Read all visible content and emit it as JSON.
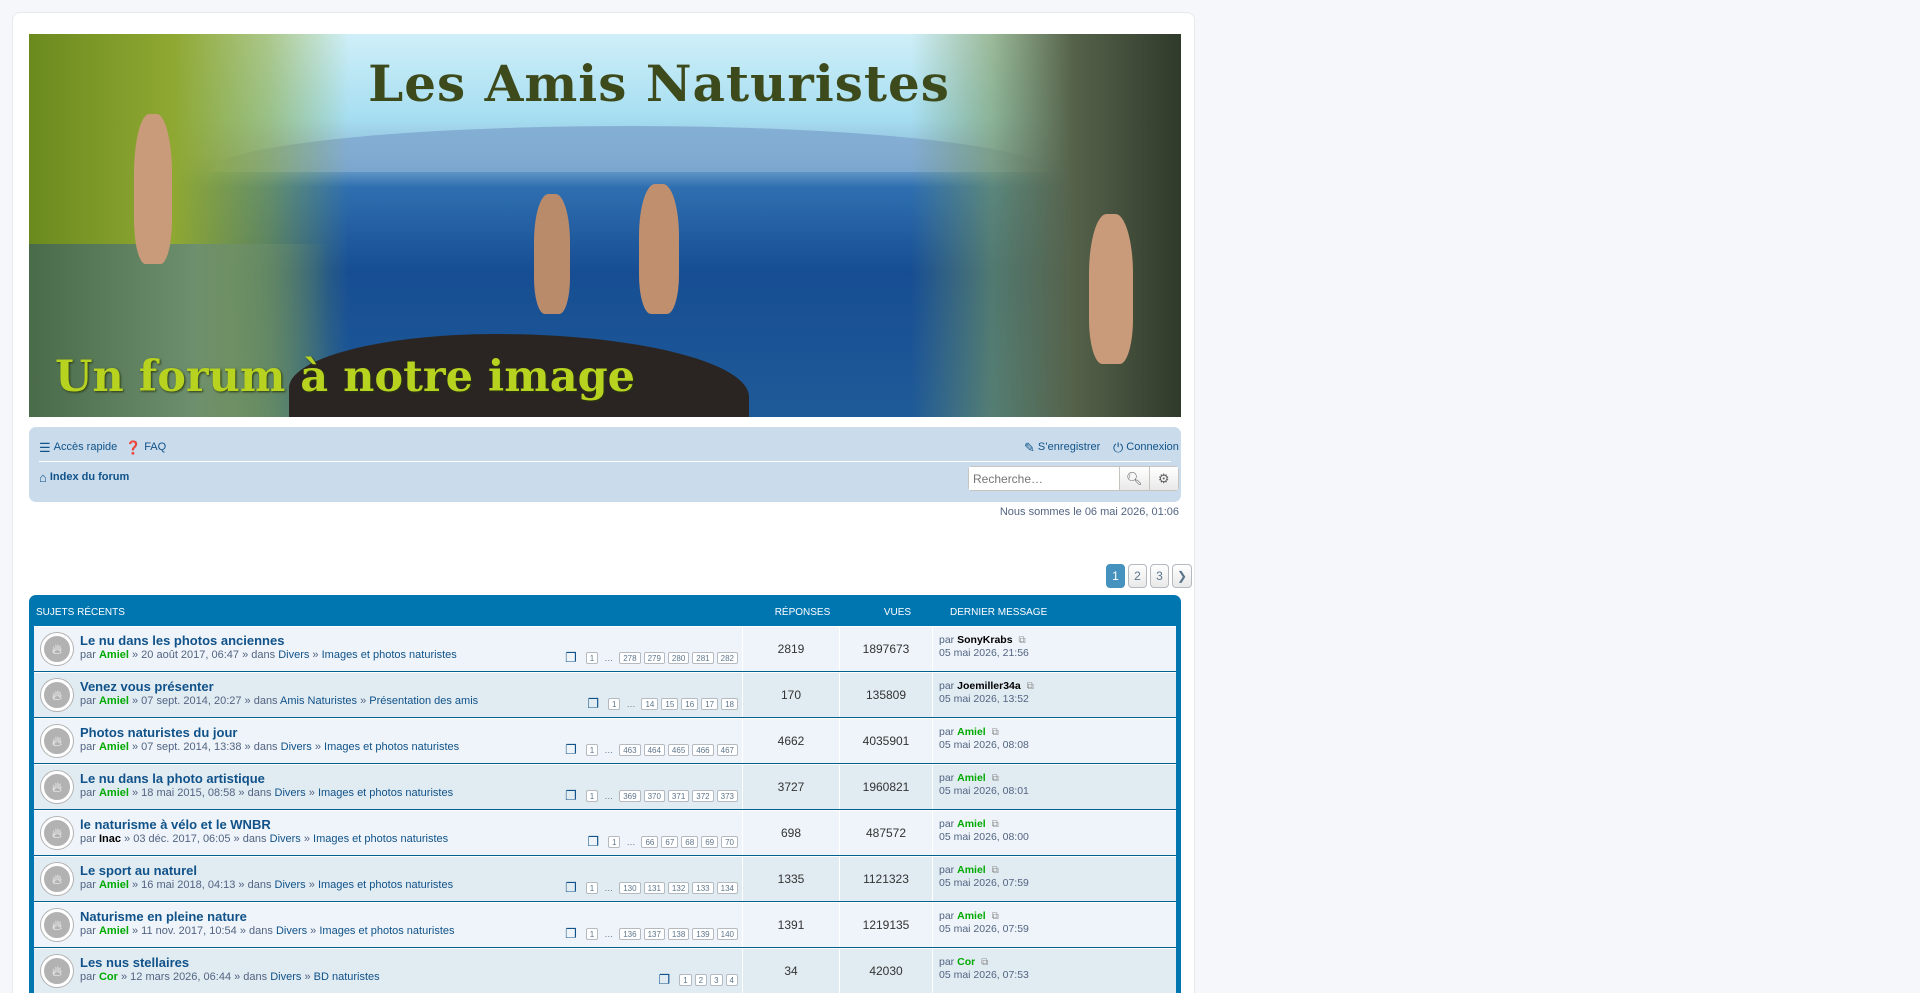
{
  "banner": {
    "title": "Les Amis Naturistes",
    "subtitle": "Un forum à notre image"
  },
  "nav": {
    "quick_access": "Accès rapide",
    "faq": "FAQ",
    "register": "S’enregistrer",
    "login": "Connexion",
    "forum_index": "Index du forum",
    "search_placeholder": "Recherche…"
  },
  "date_line": "Nous sommes le 06 mai 2026, 01:06",
  "pagination": [
    "1",
    "2",
    "3"
  ],
  "table": {
    "headers": {
      "topics": "Sujets récents",
      "replies": "Réponses",
      "views": "Vues",
      "last": "Dernier message"
    },
    "rows": [
      {
        "title": "Le nu dans les photos anciennes",
        "by": "par",
        "author": "Amiel",
        "date": "» 20 août 2017, 06:47 » dans",
        "forum1": "Divers",
        "sep": "»",
        "forum2": "Images et photos naturistes",
        "first_page": "1",
        "pages": [
          "278",
          "279",
          "280",
          "281",
          "282"
        ],
        "replies": "2819",
        "views": "1897673",
        "last_by": "par",
        "last_user": "SonyKrabs",
        "last_date": "05 mai 2026, 21:56"
      },
      {
        "title": "Venez vous présenter",
        "by": "par",
        "author": "Amiel",
        "date": "» 07 sept. 2014, 20:27 » dans",
        "forum1": "Amis Naturistes",
        "sep": "»",
        "forum2": "Présentation des amis",
        "first_page": "1",
        "pages": [
          "14",
          "15",
          "16",
          "17",
          "18"
        ],
        "replies": "170",
        "views": "135809",
        "last_by": "par",
        "last_user": "Joemiller34a",
        "last_date": "05 mai 2026, 13:52"
      },
      {
        "title": "Photos naturistes du jour",
        "by": "par",
        "author": "Amiel",
        "date": "» 07 sept. 2014, 13:38 » dans",
        "forum1": "Divers",
        "sep": "»",
        "forum2": "Images et photos naturistes",
        "first_page": "1",
        "pages": [
          "463",
          "464",
          "465",
          "466",
          "467"
        ],
        "replies": "4662",
        "views": "4035901",
        "last_by": "par",
        "last_user": "Amiel",
        "last_date": "05 mai 2026, 08:08"
      },
      {
        "title": "Le nu dans la photo artistique",
        "by": "par",
        "author": "Amiel",
        "date": "» 18 mai 2015, 08:58 » dans",
        "forum1": "Divers",
        "sep": "»",
        "forum2": "Images et photos naturistes",
        "first_page": "1",
        "pages": [
          "369",
          "370",
          "371",
          "372",
          "373"
        ],
        "replies": "3727",
        "views": "1960821",
        "last_by": "par",
        "last_user": "Amiel",
        "last_date": "05 mai 2026, 08:01"
      },
      {
        "title": "le naturisme à vélo et le WNBR",
        "by": "par",
        "author": "Inac",
        "date": "» 03 déc. 2017, 06:05 » dans",
        "forum1": "Divers",
        "sep": "»",
        "forum2": "Images et photos naturistes",
        "first_page": "1",
        "pages": [
          "66",
          "67",
          "68",
          "69",
          "70"
        ],
        "replies": "698",
        "views": "487572",
        "last_by": "par",
        "last_user": "Amiel",
        "last_date": "05 mai 2026, 08:00"
      },
      {
        "title": "Le sport au naturel",
        "by": "par",
        "author": "Amiel",
        "date": "» 16 mai 2018, 04:13 » dans",
        "forum1": "Divers",
        "sep": "»",
        "forum2": "Images et photos naturistes",
        "first_page": "1",
        "pages": [
          "130",
          "131",
          "132",
          "133",
          "134"
        ],
        "replies": "1335",
        "views": "1121323",
        "last_by": "par",
        "last_user": "Amiel",
        "last_date": "05 mai 2026, 07:59"
      },
      {
        "title": "Naturisme en pleine nature",
        "by": "par",
        "author": "Amiel",
        "date": "» 11 nov. 2017, 10:54 » dans",
        "forum1": "Divers",
        "sep": "»",
        "forum2": "Images et photos naturistes",
        "first_page": "1",
        "pages": [
          "136",
          "137",
          "138",
          "139",
          "140"
        ],
        "replies": "1391",
        "views": "1219135",
        "last_by": "par",
        "last_user": "Amiel",
        "last_date": "05 mai 2026, 07:59"
      },
      {
        "title": "Les nus stellaires",
        "by": "par",
        "author": "Cor",
        "date": "» 12 mars 2026, 06:44 » dans",
        "forum1": "Divers",
        "sep": "»",
        "forum2": "BD naturistes",
        "first_page": "1",
        "pages": [
          "2",
          "3",
          "4"
        ],
        "replies": "34",
        "views": "42030",
        "last_by": "par",
        "last_user": "Cor",
        "last_date": "05 mai 2026, 07:53"
      }
    ]
  },
  "colors": {
    "link": "#105289",
    "header_blue": "#0076b1",
    "navbar_bg": "#cadceb",
    "user_green": "#00aa00",
    "pagination_active": "#4692bf"
  },
  "icons": {
    "quick_access": "bars-icon",
    "faq": "question-icon",
    "register": "pencil-square-icon",
    "login": "power-icon",
    "home": "home-icon",
    "search": "search-icon",
    "advanced_search": "gear-icon",
    "next_page": "chevron-right-icon",
    "topic": "fire-icon",
    "pages": "copy-icon",
    "go_to_post": "external-link-icon"
  }
}
